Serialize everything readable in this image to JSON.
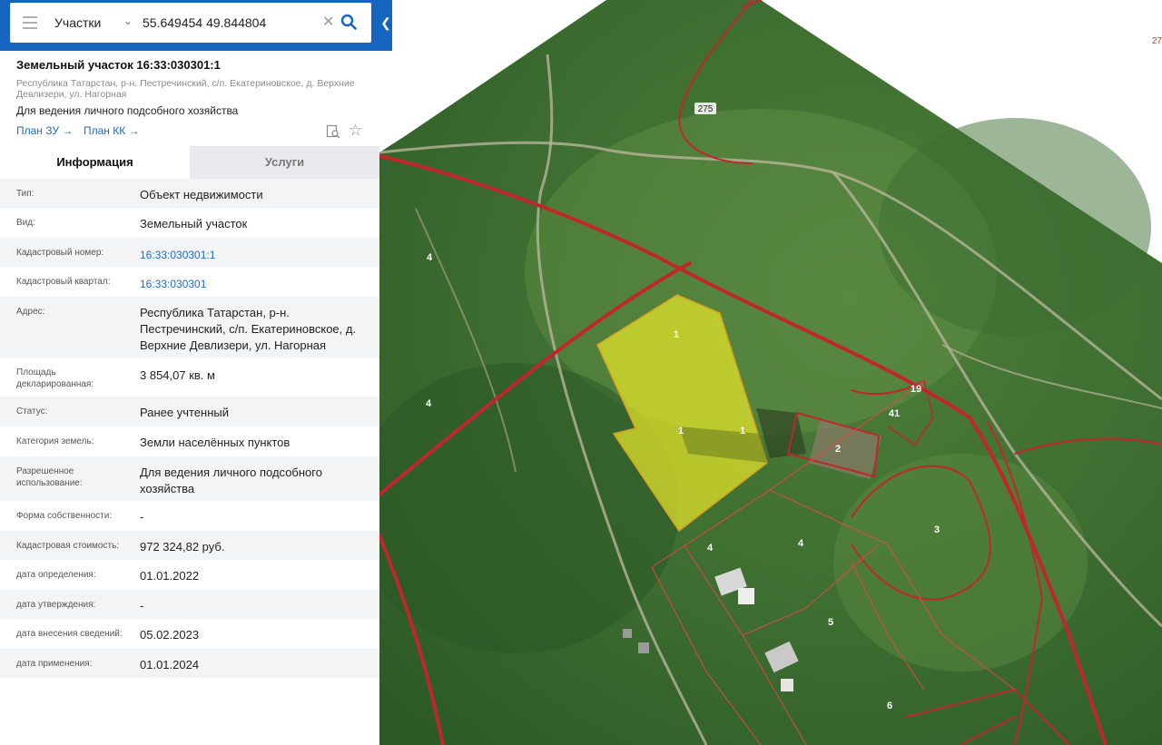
{
  "search": {
    "type_label": "Участки",
    "query": "55.649454 49.844804"
  },
  "object": {
    "title": "Земельный участок 16:33:030301:1",
    "address": "Республика Татарстан, р-н. Пестречинский, с/п. Екатериновское, д. Верхние Девлизери, ул. Нагорная",
    "use": "Для ведения личного подсобного хозяйства",
    "links": [
      "План ЗУ →",
      "План КК →"
    ]
  },
  "tabs": [
    "Информация",
    "Услуги"
  ],
  "info": [
    {
      "label": "Тип:",
      "value": "Объект недвижимости"
    },
    {
      "label": "Вид:",
      "value": "Земельный участок"
    },
    {
      "label": "Кадастровый номер:",
      "value": "16:33:030301:1"
    },
    {
      "label": "Кадастровый квартал:",
      "value": "16:33:030301"
    },
    {
      "label": "Адрес:",
      "value": "Республика Татарстан, р-н. Пестречинский, с/п. Екатериновское, д. Верхние Девлизери, ул. Нагорная"
    },
    {
      "label": "Площадь декларированная:",
      "value": "3 854,07 кв. м"
    },
    {
      "label": "Статус:",
      "value": "Ранее учтенный"
    },
    {
      "label": "Категория земель:",
      "value": "Земли населённых пунктов"
    },
    {
      "label": "Разрешенное использование:",
      "value": "Для ведения личного подсобного хозяйства"
    },
    {
      "label": "Форма собственности:",
      "value": "-"
    },
    {
      "label": "Кадастровая стоимость:",
      "value": "972 324,82 руб."
    },
    {
      "label": "дата определения:",
      "value": "01.01.2022"
    },
    {
      "label": "дата утверждения:",
      "value": "-"
    },
    {
      "label": "дата внесения сведений:",
      "value": "05.02.2023"
    },
    {
      "label": "дата применения:",
      "value": "01.01.2024"
    }
  ],
  "map": {
    "corner_label": "27",
    "parcel_labels": [
      "275",
      "4",
      "4",
      "1",
      "1",
      "1",
      "19",
      "41",
      "2",
      "3",
      "4",
      "4",
      "5",
      "6"
    ]
  },
  "colors": {
    "accent": "#1565c0",
    "link": "#1e6bb8",
    "boundary": "#c0272d",
    "selected_parcel": "#e6e62a"
  }
}
